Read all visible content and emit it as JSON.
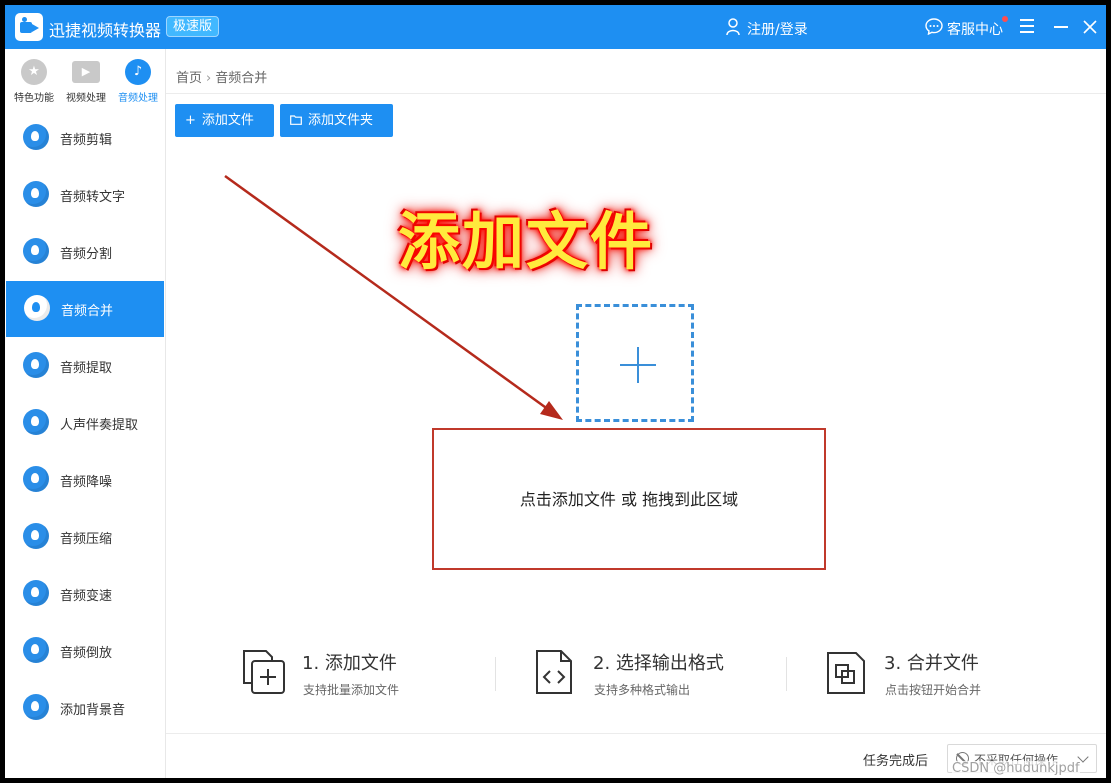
{
  "app": {
    "title": "迅捷视频转换器",
    "badge": "极速版",
    "login": "注册/登录",
    "service": "客服中心",
    "accent_color": "#1e8ff2"
  },
  "icons": {
    "logo": "camera-logo-icon",
    "user": "user-icon",
    "service": "chat-bubble-icon",
    "menu": "hamburger-menu-icon",
    "minimize": "minimize-icon",
    "close": "close-icon"
  },
  "sidebar": {
    "categories": [
      {
        "label": "特色功能",
        "icon": "star-icon",
        "active": false
      },
      {
        "label": "视频处理",
        "icon": "film-icon",
        "active": false
      },
      {
        "label": "音频处理",
        "icon": "music-note-icon",
        "active": true
      }
    ],
    "items": [
      {
        "label": "音频剪辑",
        "active": false
      },
      {
        "label": "音频转文字",
        "active": false
      },
      {
        "label": "音频分割",
        "active": false
      },
      {
        "label": "音频合并",
        "active": true
      },
      {
        "label": "音频提取",
        "active": false
      },
      {
        "label": "人声伴奏提取",
        "active": false
      },
      {
        "label": "音频降噪",
        "active": false
      },
      {
        "label": "音频压缩",
        "active": false
      },
      {
        "label": "音频变速",
        "active": false
      },
      {
        "label": "音频倒放",
        "active": false
      },
      {
        "label": "添加背景音",
        "active": false
      }
    ]
  },
  "breadcrumb": {
    "home": "首页",
    "current": "音频合并"
  },
  "toolbar": {
    "add_file": "添加文件",
    "add_folder": "添加文件夹"
  },
  "annotation": {
    "headline": "添加文件",
    "headline_color": "#ffea3d",
    "glow_color": "#ff0000"
  },
  "dropzone": {
    "hint": "点击添加文件 或 拖拽到此区域"
  },
  "steps": [
    {
      "title": "1. 添加文件",
      "desc": "支持批量添加文件",
      "icon": "add-file-icon"
    },
    {
      "title": "2. 选择输出格式",
      "desc": "支持多种格式输出",
      "icon": "code-file-icon"
    },
    {
      "title": "3. 合并文件",
      "desc": "点击按钮开始合并",
      "icon": "merge-icon"
    }
  ],
  "footer": {
    "after_label": "任务完成后",
    "after_value": "不采取任何操作"
  },
  "watermark": "CSDN @hudunkjpdf"
}
